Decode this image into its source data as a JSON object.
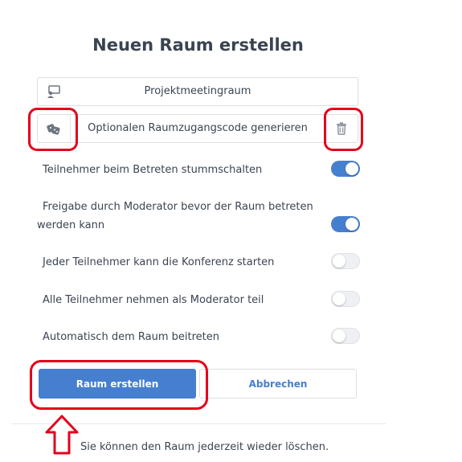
{
  "modal": {
    "title": "Neuen Raum erstellen"
  },
  "room_name": {
    "value": "Projektmeetingraum",
    "icon": "presentation-icon"
  },
  "access_code": {
    "label": "Optionalen Raumzugangscode generieren",
    "icon": "dice-icon",
    "delete_icon": "trash-icon"
  },
  "settings": [
    {
      "label": "Teilnehmer beim Betreten stummschalten",
      "enabled": true
    },
    {
      "label": "Freigabe durch Moderator bevor der Raum betreten werden kann",
      "enabled": true
    },
    {
      "label": "Jeder Teilnehmer kann die Konferenz starten",
      "enabled": false
    },
    {
      "label": "Alle Teilnehmer nehmen als Moderator teil",
      "enabled": false
    },
    {
      "label": "Automatisch dem Raum beitreten",
      "enabled": false
    }
  ],
  "buttons": {
    "create": "Raum erstellen",
    "cancel": "Abbrechen"
  },
  "footer": {
    "text": "Sie können den Raum jederzeit wieder löschen."
  },
  "colors": {
    "accent": "#467fcf",
    "highlight": "#e3001b",
    "text": "#3a4451"
  }
}
